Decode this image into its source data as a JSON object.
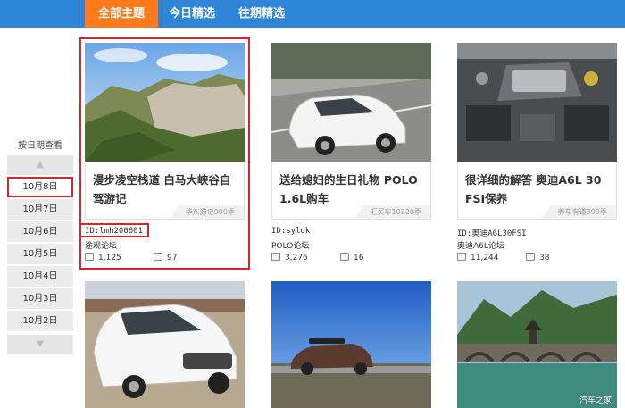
{
  "tabs": [
    {
      "label": "全部主题",
      "active": true
    },
    {
      "label": "今日精选",
      "active": false
    },
    {
      "label": "往期精选",
      "active": false
    }
  ],
  "sidebar": {
    "title": "按日期查看",
    "up_arrow": "▲",
    "down_arrow": "▼",
    "dates": [
      "10月8日",
      "10月7日",
      "10月6日",
      "10月5日",
      "10月4日",
      "10月3日",
      "10月2日"
    ],
    "active_index": 0
  },
  "cards": [
    {
      "title": "漫步凌空栈道 白马大峡谷自驾游记",
      "source": "华东游记900季",
      "uid": "ID:lmh200801",
      "forum": "途观论坛",
      "views": "1,125",
      "comments": "97"
    },
    {
      "title": "送给媳妇的生日礼物 POLO 1.6L购车",
      "source": "汇买车10220季",
      "uid": "ID:syldk",
      "forum": "POLO论坛",
      "views": "3,276",
      "comments": "16"
    },
    {
      "title": "很详细的解答 奥迪A6L 30 FSI保养",
      "source": "养车有道399季",
      "uid": "ID:奥迪A6L30FSI",
      "forum": "奥迪A6L论坛",
      "views": "11,244",
      "comments": "38"
    }
  ],
  "watermark": "汽车之家",
  "colors": {
    "nav": "#2f85d8",
    "active_tab": "#ff7a1a",
    "highlight": "#d6262d"
  }
}
